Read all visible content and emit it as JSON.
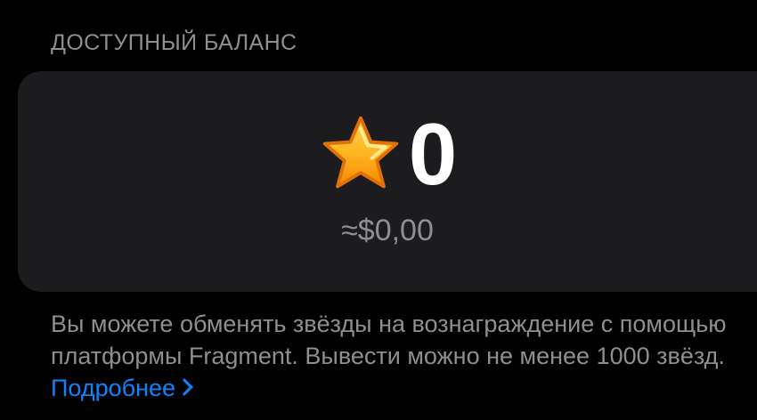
{
  "section": {
    "title": "ДОСТУПНЫЙ БАЛАНС"
  },
  "balance": {
    "icon": "star-icon",
    "value": "0",
    "usd": "≈$0,00"
  },
  "footer": {
    "text": "Вы можете обменять звёзды на вознаграждение с помощью платформы Fragment. Вывести можно не менее 1000 звёзд.",
    "link_label": "Подробнее",
    "link_icon": "chevron-right-icon"
  },
  "colors": {
    "background": "#000000",
    "card": "#1c1c1e",
    "secondary_text": "#8e8e93",
    "link": "#0a84ff",
    "star": "#ffb020"
  }
}
